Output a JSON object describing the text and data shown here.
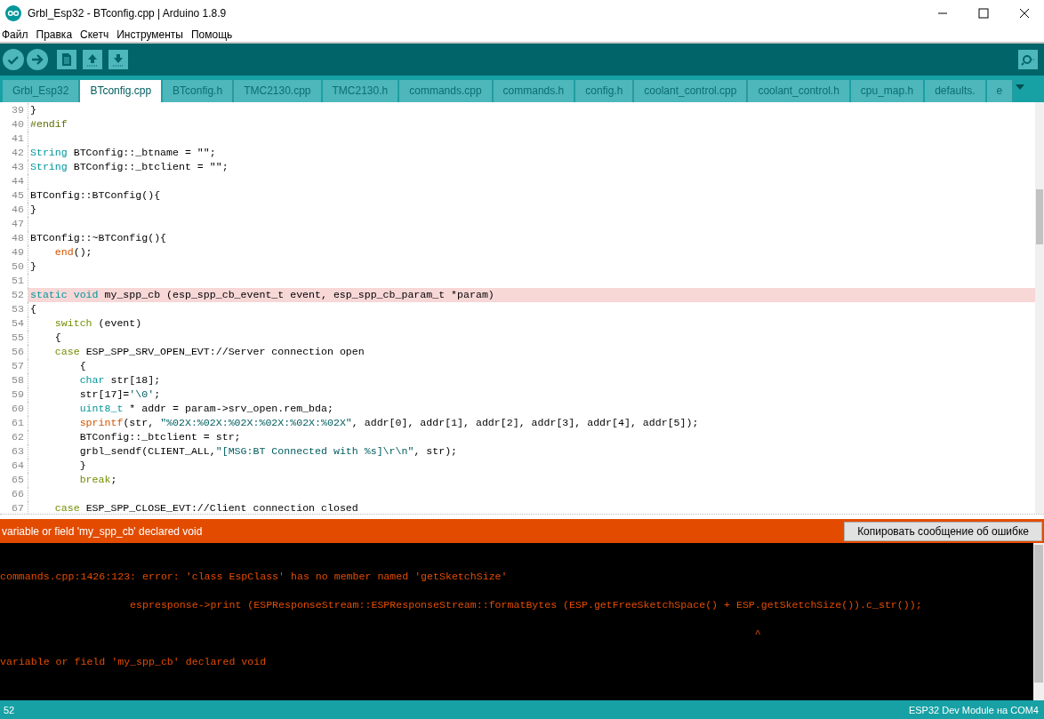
{
  "window": {
    "title": "Grbl_Esp32 - BTconfig.cpp | Arduino 1.8.9"
  },
  "menu": [
    "Файл",
    "Правка",
    "Скетч",
    "Инструменты",
    "Помощь"
  ],
  "tabs": [
    {
      "label": "Grbl_Esp32",
      "selected": false
    },
    {
      "label": "BTconfig.cpp",
      "selected": true
    },
    {
      "label": "BTconfig.h",
      "selected": false
    },
    {
      "label": "TMC2130.cpp",
      "selected": false
    },
    {
      "label": "TMC2130.h",
      "selected": false
    },
    {
      "label": "commands.cpp",
      "selected": false
    },
    {
      "label": "commands.h",
      "selected": false
    },
    {
      "label": "config.h",
      "selected": false
    },
    {
      "label": "coolant_control.cpp",
      "selected": false
    },
    {
      "label": "coolant_control.h",
      "selected": false
    },
    {
      "label": "cpu_map.h",
      "selected": false
    },
    {
      "label": "defaults.",
      "selected": false
    },
    {
      "label": "e",
      "selected": false
    }
  ],
  "editor": {
    "lines": [
      {
        "number": "39",
        "highlighted": false,
        "segments": [
          {
            "kind": "plain",
            "text": "}"
          }
        ]
      },
      {
        "number": "40",
        "highlighted": false,
        "segments": [
          {
            "kind": "preproc",
            "text": "#endif"
          }
        ]
      },
      {
        "number": "41",
        "highlighted": false
      },
      {
        "number": "42",
        "highlighted": false,
        "segments": [
          {
            "kind": "type",
            "text": "String"
          },
          {
            "kind": "plain",
            "text": " BTConfig::_btname = \"\";"
          }
        ]
      },
      {
        "number": "43",
        "highlighted": false,
        "segments": [
          {
            "kind": "type",
            "text": "String"
          },
          {
            "kind": "plain",
            "text": " BTConfig::_btclient = \"\";"
          }
        ]
      },
      {
        "number": "44",
        "highlighted": false
      },
      {
        "number": "45",
        "highlighted": false,
        "segments": [
          {
            "kind": "plain",
            "text": "BTConfig::BTConfig(){"
          }
        ]
      },
      {
        "number": "46",
        "highlighted": false,
        "segments": [
          {
            "kind": "plain",
            "text": "}"
          }
        ]
      },
      {
        "number": "47",
        "highlighted": false
      },
      {
        "number": "48",
        "highlighted": false,
        "segments": [
          {
            "kind": "plain",
            "text": "BTConfig::~BTConfig(){"
          }
        ]
      },
      {
        "number": "49",
        "highlighted": false,
        "segments": [
          {
            "kind": "func",
            "text": "    end"
          },
          {
            "kind": "plain",
            "text": "();"
          }
        ]
      },
      {
        "number": "50",
        "highlighted": false,
        "segments": [
          {
            "kind": "plain",
            "text": "}"
          }
        ]
      },
      {
        "number": "51",
        "highlighted": false
      },
      {
        "number": "52",
        "highlighted": true,
        "segments": [
          {
            "kind": "type",
            "text": "static void"
          },
          {
            "kind": "plain",
            "text": " my_spp_cb (esp_spp_cb_event_t event, esp_spp_cb_param_t *param)"
          }
        ]
      },
      {
        "number": "53",
        "highlighted": false,
        "segments": [
          {
            "kind": "plain",
            "text": "{"
          }
        ]
      },
      {
        "number": "54",
        "highlighted": false,
        "segments": [
          {
            "kind": "keyword",
            "text": "    switch"
          },
          {
            "kind": "plain",
            "text": " (event)"
          }
        ]
      },
      {
        "number": "55",
        "highlighted": false,
        "segments": [
          {
            "kind": "plain",
            "text": "    {"
          }
        ]
      },
      {
        "number": "56",
        "highlighted": false,
        "segments": [
          {
            "kind": "keyword",
            "text": "    case"
          },
          {
            "kind": "plain",
            "text": " ESP_SPP_SRV_OPEN_EVT://Server connection open"
          }
        ]
      },
      {
        "number": "57",
        "highlighted": false,
        "segments": [
          {
            "kind": "plain",
            "text": "        {"
          }
        ]
      },
      {
        "number": "58",
        "highlighted": false,
        "segments": [
          {
            "kind": "type",
            "text": "        char"
          },
          {
            "kind": "plain",
            "text": " str[18];"
          }
        ]
      },
      {
        "number": "59",
        "highlighted": false,
        "segments": [
          {
            "kind": "plain",
            "text": "        str[17]="
          },
          {
            "kind": "string",
            "text": "'\\0'"
          },
          {
            "kind": "plain",
            "text": ";"
          }
        ]
      },
      {
        "number": "60",
        "highlighted": false,
        "segments": [
          {
            "kind": "type",
            "text": "        uint8_t"
          },
          {
            "kind": "plain",
            "text": " * addr = param->srv_open.rem_bda;"
          }
        ]
      },
      {
        "number": "61",
        "highlighted": false,
        "segments": [
          {
            "kind": "func",
            "text": "        sprintf"
          },
          {
            "kind": "plain",
            "text": "(str, "
          },
          {
            "kind": "string",
            "text": "\"%02X:%02X:%02X:%02X:%02X:%02X\""
          },
          {
            "kind": "plain",
            "text": ", addr[0], addr[1], addr[2], addr[3], addr[4], addr[5]);"
          }
        ]
      },
      {
        "number": "62",
        "highlighted": false,
        "segments": [
          {
            "kind": "plain",
            "text": "        BTConfig::_btclient = str;"
          }
        ]
      },
      {
        "number": "63",
        "highlighted": false,
        "segments": [
          {
            "kind": "plain",
            "text": "        grbl_sendf(CLIENT_ALL,"
          },
          {
            "kind": "string",
            "text": "\"[MSG:BT Connected with %s]\\r\\n\""
          },
          {
            "kind": "plain",
            "text": ", str);"
          }
        ]
      },
      {
        "number": "64",
        "highlighted": false,
        "segments": [
          {
            "kind": "plain",
            "text": "        }"
          }
        ]
      },
      {
        "number": "65",
        "highlighted": false,
        "segments": [
          {
            "kind": "keyword",
            "text": "        break"
          },
          {
            "kind": "plain",
            "text": ";"
          }
        ]
      },
      {
        "number": "66",
        "highlighted": false
      },
      {
        "number": "67",
        "highlighted": false,
        "segments": [
          {
            "kind": "keyword",
            "text": "    case"
          },
          {
            "kind": "plain",
            "text": " ESP_SPP_CLOSE_EVT://Client connection closed"
          }
        ]
      }
    ]
  },
  "error_bar": {
    "message": "variable or field 'my_spp_cb' declared void",
    "button": "Копировать сообщение об ошибке"
  },
  "console": {
    "lines": [
      "commands.cpp:1426:123: error: 'class EspClass' has no member named 'getSketchSize'",
      "                     espresponse->print (ESPResponseStream::ESPResponseStream::formatBytes (ESP.getFreeSketchSpace() + ESP.getSketchSize()).c_str());",
      "                                                                                                                          ^",
      "variable or field 'my_spp_cb' declared void"
    ]
  },
  "status_bar": {
    "line": "52",
    "board": "ESP32 Dev Module на COM4"
  }
}
